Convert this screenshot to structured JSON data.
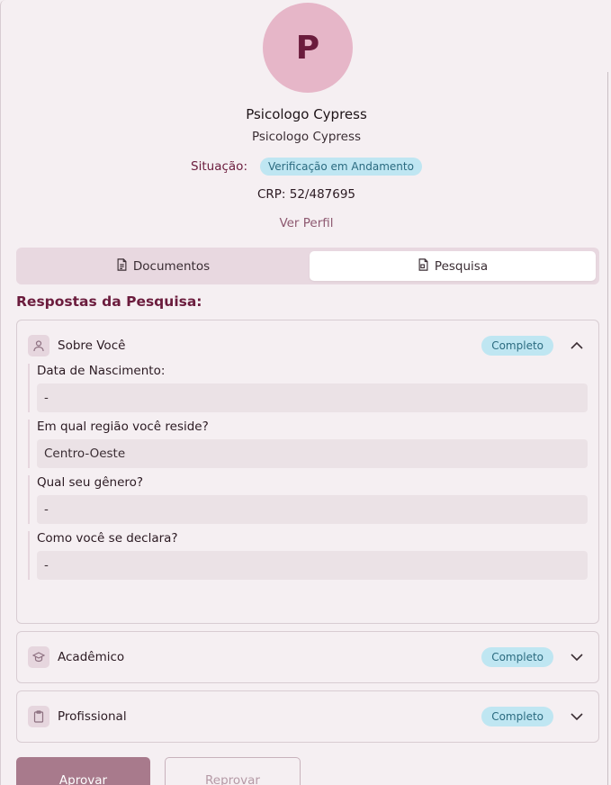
{
  "profile": {
    "avatar_letter": "P",
    "name": "Psicologo Cypress",
    "subname": "Psicologo Cypress",
    "situacao_label": "Situação:",
    "status": "Verificação em Andamento",
    "crp": "CRP: 52/487695",
    "ver_perfil": "Ver Perfil"
  },
  "tabs": [
    {
      "label": "Documentos",
      "icon": "document-icon",
      "active": false
    },
    {
      "label": "Pesquisa",
      "icon": "survey-icon",
      "active": true
    }
  ],
  "section_title": "Respostas da Pesquisa:",
  "categories": [
    {
      "label": "Sobre Você",
      "icon": "user-icon",
      "badge": "Completo",
      "expanded": true,
      "questions": [
        {
          "question": "Data de Nascimento:",
          "answer": "-"
        },
        {
          "question": "Em qual região você reside?",
          "answer": "Centro-Oeste"
        },
        {
          "question": "Qual seu gênero?",
          "answer": "-"
        },
        {
          "question": "Como você se declara?",
          "answer": "-"
        }
      ]
    },
    {
      "label": "Acadêmico",
      "icon": "graduation-cap-icon",
      "badge": "Completo",
      "expanded": false
    },
    {
      "label": "Profissional",
      "icon": "clipboard-icon",
      "badge": "Completo",
      "expanded": false
    }
  ],
  "actions": {
    "approve": "Aprovar",
    "reject": "Reprovar"
  },
  "colors": {
    "accent": "#6b1c3d",
    "avatar_bg": "#e6b6c8",
    "badge_bg": "#bfe6f2",
    "approve_bg": "#a87a8c"
  }
}
